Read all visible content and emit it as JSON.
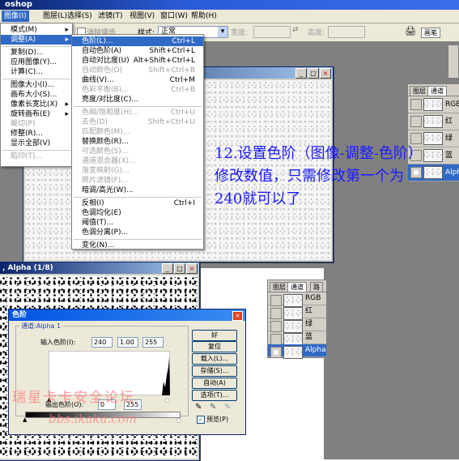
{
  "app": {
    "title": "oshop"
  },
  "menubar": {
    "items": [
      {
        "key": "image",
        "label": "图像(I)"
      },
      {
        "key": "layer",
        "label": "图层(L)"
      },
      {
        "key": "select",
        "label": "选择(S)"
      },
      {
        "key": "filter",
        "label": "滤镜(T)"
      },
      {
        "key": "view",
        "label": "视图(V)"
      },
      {
        "key": "window",
        "label": "窗口(W)"
      },
      {
        "key": "help",
        "label": "帮助(H)"
      }
    ]
  },
  "toolbar": {
    "antialias": "消除锯齿",
    "style_label": "样式:",
    "style_value": "正常",
    "width_label": "宽度:",
    "height_label": "高度:",
    "brush_tab": "画笔"
  },
  "image_menu": {
    "items": [
      {
        "label": "模式(M)",
        "sub": true
      },
      {
        "label": "调整(A)",
        "sub": true,
        "hl": true
      },
      {
        "sep": true
      },
      {
        "label": "复制(D)..."
      },
      {
        "label": "应用图像(Y)..."
      },
      {
        "label": "计算(C)..."
      },
      {
        "sep": true
      },
      {
        "label": "图像大小(I)..."
      },
      {
        "label": "画布大小(S)..."
      },
      {
        "label": "像素长宽比(X)",
        "sub": true
      },
      {
        "label": "旋转画布(E)",
        "sub": true
      },
      {
        "label": "裁切(P)",
        "dis": true
      },
      {
        "label": "修整(R)..."
      },
      {
        "label": "显示全部(V)"
      },
      {
        "sep": true
      },
      {
        "label": "陷印(T)...",
        "dis": true
      }
    ]
  },
  "adjust_menu": {
    "items": [
      {
        "label": "色阶(L)...",
        "sc": "Ctrl+L",
        "hl": true
      },
      {
        "label": "自动色阶(A)",
        "sc": "Shift+Ctrl+L"
      },
      {
        "label": "自动对比度(U)",
        "sc": "Alt+Shift+Ctrl+L"
      },
      {
        "label": "自动颜色(O)",
        "sc": "Shift+Ctrl+B",
        "dis": true
      },
      {
        "label": "曲线(V)...",
        "sc": "Ctrl+M"
      },
      {
        "label": "色彩平衡(B)...",
        "sc": "Ctrl+B",
        "dis": true
      },
      {
        "label": "亮度/对比度(C)..."
      },
      {
        "sep": true
      },
      {
        "label": "色相/饱和度(H)...",
        "sc": "Ctrl+U",
        "dis": true
      },
      {
        "label": "去色(D)",
        "sc": "Shift+Ctrl+U",
        "dis": true
      },
      {
        "label": "匹配颜色(M)...",
        "dis": true
      },
      {
        "label": "替换颜色(R)..."
      },
      {
        "label": "可选颜色(S)...",
        "dis": true
      },
      {
        "label": "通道混合器(X)...",
        "dis": true
      },
      {
        "label": "渐变映射(G)...",
        "dis": true
      },
      {
        "label": "照片滤镜(F)...",
        "dis": true
      },
      {
        "label": "暗调/高光(W)..."
      },
      {
        "sep": true
      },
      {
        "label": "反相(I)",
        "sc": "Ctrl+I"
      },
      {
        "label": "色调均化(E)"
      },
      {
        "label": "阈值(T)..."
      },
      {
        "label": "色调分离(P)..."
      },
      {
        "sep": true
      },
      {
        "label": "变化(N)..."
      }
    ]
  },
  "channels_top": {
    "tabs": [
      "图层",
      "通道"
    ],
    "rows": [
      {
        "label": "RGB"
      },
      {
        "label": "红"
      },
      {
        "label": "绿"
      },
      {
        "label": "蓝"
      },
      {
        "label": "Alpha",
        "sel": true
      }
    ]
  },
  "channels_bottom": {
    "tabs": [
      "图层",
      "通道",
      "路"
    ],
    "rows": [
      {
        "label": "RGB"
      },
      {
        "label": "红"
      },
      {
        "label": "绿"
      },
      {
        "label": "蓝"
      },
      {
        "label": "Alpha",
        "sel": true
      }
    ]
  },
  "annotation": {
    "text": "12.设置色阶（图像-调整-色阶）修改数值，只需修改第一个为240就可以了",
    "color": "#1a1aff"
  },
  "doc2": {
    "title": ", Alpha (1/8)"
  },
  "levels": {
    "title": "色阶",
    "channel": "通道:Alpha 1",
    "input_label": "输入色阶(I):",
    "in_black": "240",
    "in_gamma": "1.00",
    "in_white": "255",
    "output_label": "输出色阶(O):",
    "out_black": "0",
    "out_white": "255",
    "buttons": {
      "ok": "好",
      "reset": "复位",
      "load": "载入(L)...",
      "save": "存储(S)...",
      "auto": "自动(A)",
      "options": "选项(T)..."
    },
    "preview": "预览(P)"
  },
  "watermark": {
    "cn": "瑞星卡卡安全论坛",
    "url": "bbs.ikaka.com",
    "color": "#ff7a7a"
  }
}
